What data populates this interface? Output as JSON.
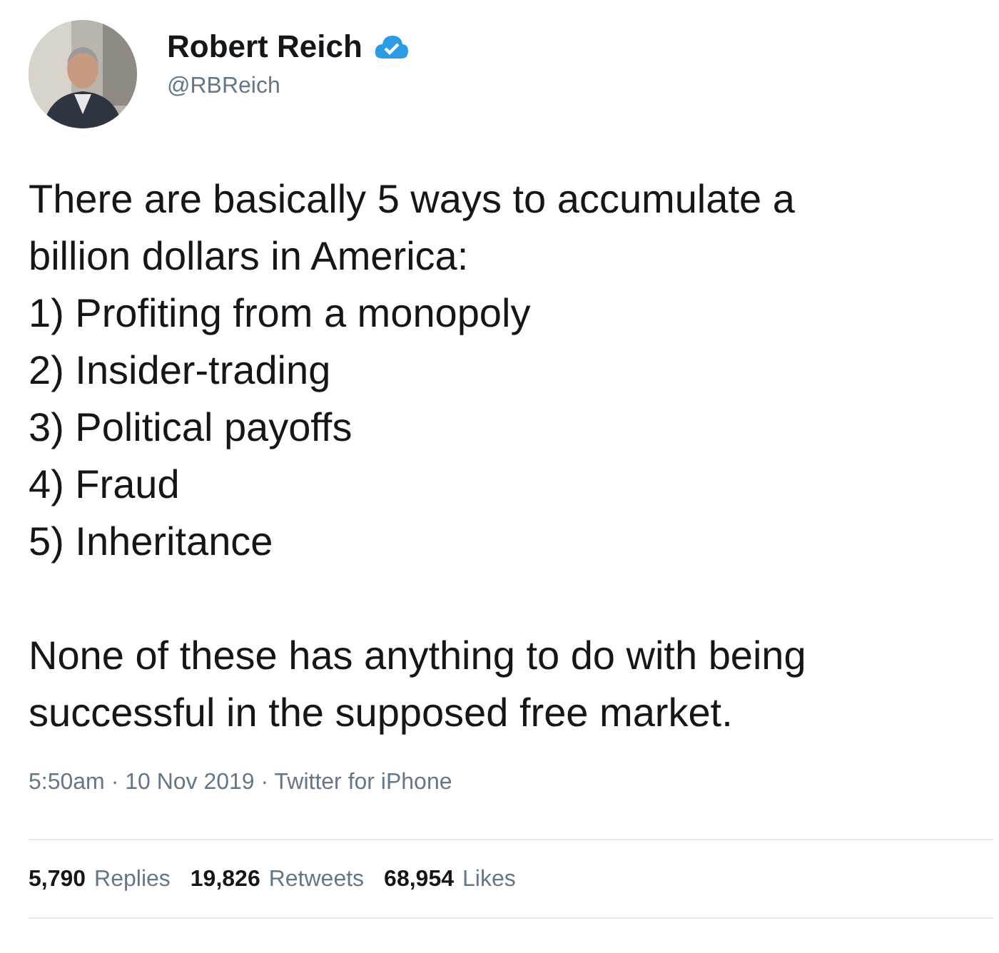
{
  "author": {
    "name": "Robert Reich",
    "handle": "@RBReich",
    "verified": true
  },
  "tweet": {
    "intro": "There are basically 5 ways to accumulate a billion dollars in America:",
    "list": [
      "1) Profiting from a monopoly",
      "2) Insider-trading",
      "3) Political payoffs",
      "4) Fraud",
      "5) Inheritance"
    ],
    "closing": "None of these has anything to do with being successful in the supposed free market."
  },
  "meta": {
    "timestamp": "5:50am · 10 Nov 2019 · Twitter for iPhone"
  },
  "stats": [
    {
      "count": "5,790",
      "label": "Replies"
    },
    {
      "count": "19,826",
      "label": "Retweets"
    },
    {
      "count": "68,954",
      "label": "Likes"
    }
  ]
}
